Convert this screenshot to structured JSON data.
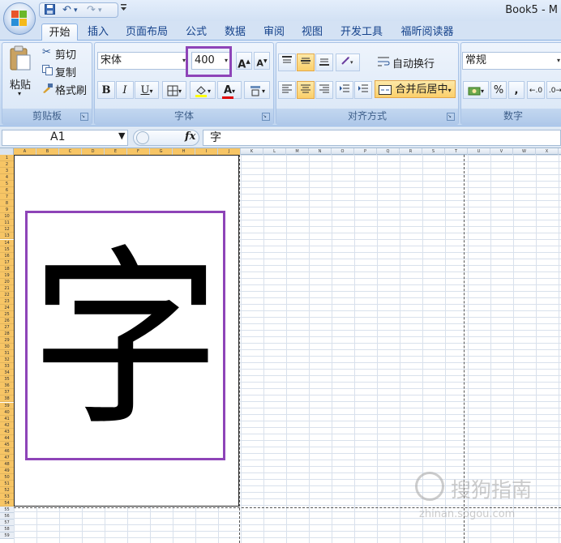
{
  "window": {
    "title": "Book5 - M"
  },
  "quick_access": {
    "undo": "↶",
    "redo": "↷",
    "dropdown": "▾"
  },
  "tabs": [
    {
      "label": "开始",
      "active": true
    },
    {
      "label": "插入"
    },
    {
      "label": "页面布局"
    },
    {
      "label": "公式"
    },
    {
      "label": "数据"
    },
    {
      "label": "审阅"
    },
    {
      "label": "视图"
    },
    {
      "label": "开发工具"
    },
    {
      "label": "福昕阅读器"
    }
  ],
  "clipboard": {
    "paste": "粘贴",
    "cut": "剪切",
    "copy": "复制",
    "format_painter": "格式刷",
    "label": "剪贴板"
  },
  "font": {
    "name": "宋体",
    "size": "400",
    "grow": "A",
    "shrink": "A",
    "bold": "B",
    "italic": "I",
    "underline": "U",
    "font_color_letter": "A",
    "label": "字体",
    "font_color": "#e00000",
    "fill_color": "#ffff00"
  },
  "alignment": {
    "wrap": "自动换行",
    "merge": "合并后居中",
    "label": "对齐方式"
  },
  "number": {
    "format": "常规",
    "percent": "%",
    "comma": ",",
    "label": "数字"
  },
  "formula_bar": {
    "name_box": "A1",
    "fx": "fx",
    "content": "字"
  },
  "sheet": {
    "columns": [
      "A",
      "B",
      "C",
      "D",
      "E",
      "F",
      "G",
      "H",
      "I",
      "J",
      "K",
      "L",
      "M",
      "N",
      "O",
      "P",
      "Q",
      "R",
      "S",
      "T",
      "U",
      "V",
      "W",
      "X"
    ],
    "merged_cell_text": "字",
    "accent": "#8e44b8"
  },
  "watermark": {
    "text": "搜狗指南",
    "url": "zhinan.sogou.com"
  }
}
